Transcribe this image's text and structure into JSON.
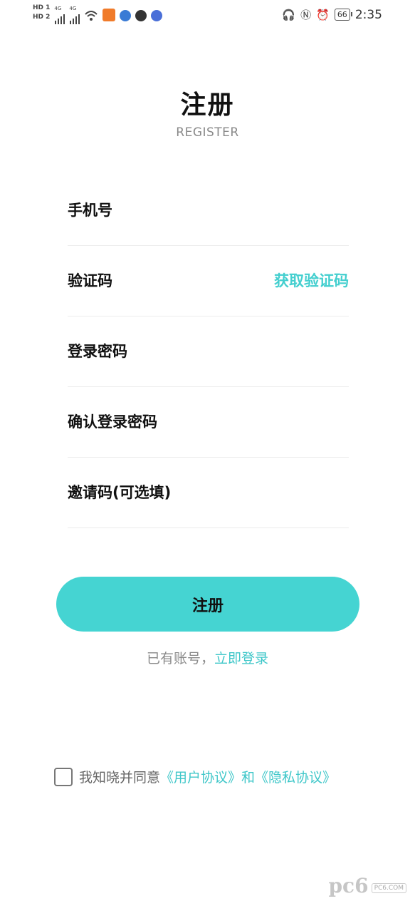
{
  "status_bar": {
    "left_badges": [
      "HD 1",
      "HD 2"
    ],
    "network_tags": [
      "4G",
      "4G"
    ],
    "time": "2:35",
    "battery": "66"
  },
  "header": {
    "title": "注册",
    "subtitle": "REGISTER"
  },
  "form": {
    "phone_placeholder": "手机号",
    "code_placeholder": "验证码",
    "get_code_label": "获取验证码",
    "password_placeholder": "登录密码",
    "confirm_password_placeholder": "确认登录密码",
    "invite_code_placeholder": "邀请码(可选填)"
  },
  "submit_label": "注册",
  "login_prompt": {
    "text": "已有账号，",
    "link": "立即登录"
  },
  "agreement": {
    "prefix": "我知晓并同意",
    "user_agreement": "《用户协议》",
    "and": "和",
    "privacy_policy": "《隐私协议》"
  },
  "watermark": {
    "logo": "pc6",
    "box": "PC6.COM"
  },
  "colors": {
    "accent": "#45d4d2",
    "link": "#3fc7c9",
    "muted_text": "#8a8a8a"
  }
}
